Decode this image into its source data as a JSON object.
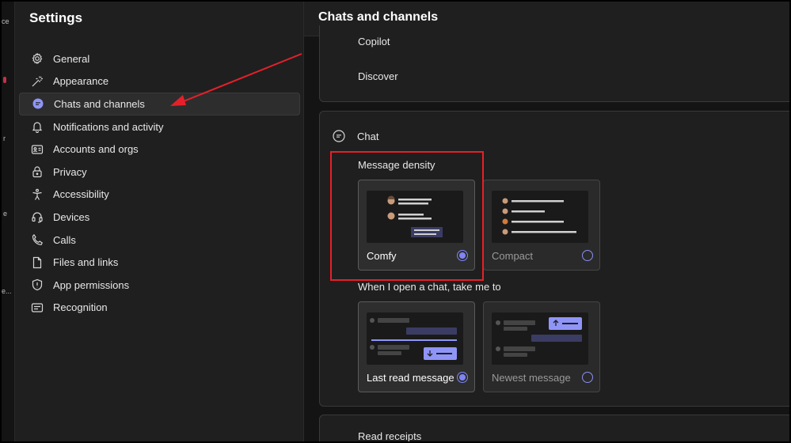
{
  "rail": {
    "fragments": [
      "ce",
      "r",
      "e",
      "e..."
    ]
  },
  "settings": {
    "title": "Settings",
    "nav": [
      {
        "label": "General",
        "icon": "gear-icon",
        "active": false
      },
      {
        "label": "Appearance",
        "icon": "magic-wand-icon",
        "active": false
      },
      {
        "label": "Chats and channels",
        "icon": "chat-bubble-icon",
        "active": true
      },
      {
        "label": "Notifications and activity",
        "icon": "bell-icon",
        "active": false
      },
      {
        "label": "Accounts and orgs",
        "icon": "id-card-icon",
        "active": false
      },
      {
        "label": "Privacy",
        "icon": "lock-icon",
        "active": false
      },
      {
        "label": "Accessibility",
        "icon": "accessibility-icon",
        "active": false
      },
      {
        "label": "Devices",
        "icon": "headset-icon",
        "active": false
      },
      {
        "label": "Calls",
        "icon": "phone-icon",
        "active": false
      },
      {
        "label": "Files and links",
        "icon": "file-icon",
        "active": false
      },
      {
        "label": "App permissions",
        "icon": "shield-icon",
        "active": false
      },
      {
        "label": "Recognition",
        "icon": "badge-icon",
        "active": false
      }
    ]
  },
  "main": {
    "title": "Chats and channels",
    "top_card": {
      "items": [
        "Copilot",
        "Discover"
      ]
    },
    "chat_section": {
      "heading": "Chat",
      "message_density": {
        "label": "Message density",
        "options": [
          {
            "label": "Comfy",
            "selected": true
          },
          {
            "label": "Compact",
            "selected": false
          }
        ]
      },
      "open_chat": {
        "label": "When I open a chat, take me to",
        "options": [
          {
            "label": "Last read message",
            "selected": true
          },
          {
            "label": "Newest message",
            "selected": false
          }
        ]
      }
    },
    "bottom_card": {
      "heading": "Read receipts"
    }
  },
  "colors": {
    "accent": "#7f85f5",
    "annotation_red": "#e5202a",
    "panel_bg": "#1f1f1f",
    "main_bg": "#141414"
  }
}
